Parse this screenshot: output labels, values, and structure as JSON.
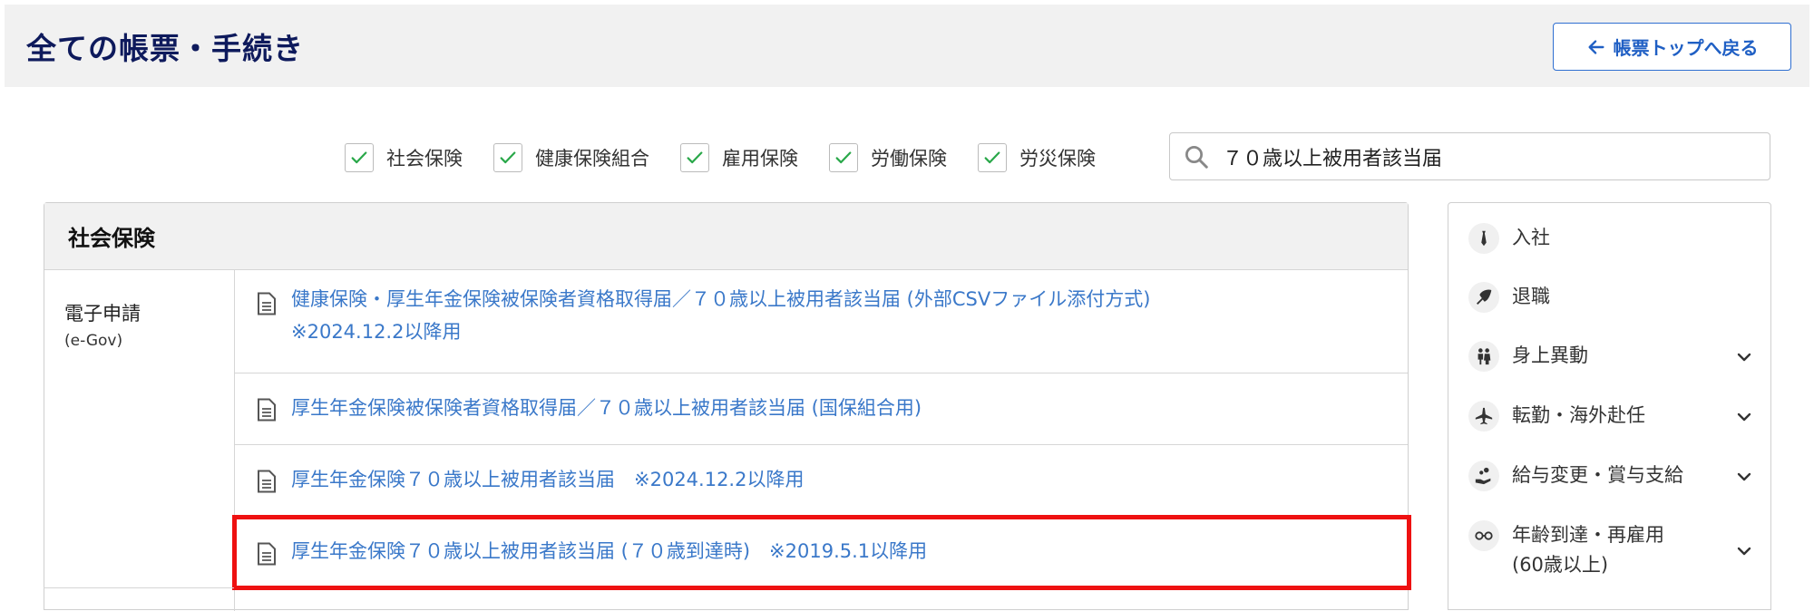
{
  "header": {
    "title": "全ての帳票・手続き",
    "back_label": "帳票トップへ戻る"
  },
  "filters": [
    {
      "label": "社会保険",
      "checked": true
    },
    {
      "label": "健康保険組合",
      "checked": true
    },
    {
      "label": "雇用保険",
      "checked": true
    },
    {
      "label": "労働保険",
      "checked": true
    },
    {
      "label": "労災保険",
      "checked": true
    }
  ],
  "search": {
    "value": "７０歳以上被用者該当届"
  },
  "panel": {
    "title": "社会保険",
    "category": {
      "title": "電子申請",
      "subtitle": "(e-Gov)"
    },
    "documents": [
      {
        "line1": "健康保険・厚生年金保険被保険者資格取得届／７０歳以上被用者該当届 (外部CSVファイル添付方式)",
        "line2": "※2024.12.2以降用"
      },
      {
        "line1": "厚生年金保険被保険者資格取得届／７０歳以上被用者該当届 (国保組合用)"
      },
      {
        "line1": "厚生年金保険７０歳以上被用者該当届　※2024.12.2以降用"
      },
      {
        "line1": "厚生年金保険７０歳以上被用者該当届 (７０歳到達時)　※2019.5.1以降用",
        "highlighted": true
      }
    ]
  },
  "sidebar": {
    "items": [
      {
        "label": "入社",
        "icon": "necktie-icon",
        "expandable": false
      },
      {
        "label": "退職",
        "icon": "bouquet-icon",
        "expandable": false
      },
      {
        "label": "身上異動",
        "icon": "couple-icon",
        "expandable": true
      },
      {
        "label": "転勤・海外赴任",
        "icon": "airplane-icon",
        "expandable": true
      },
      {
        "label": "給与変更・賞与支給",
        "icon": "coins-hand-icon",
        "expandable": true
      },
      {
        "label": "年齢到達・再雇用",
        "label2": "(60歳以上)",
        "icon": "glasses-icon",
        "expandable": true
      }
    ]
  },
  "colors": {
    "link": "#3a78c9",
    "title": "#0e1a5c",
    "highlight": "#ee1111",
    "check": "#2aa84a"
  }
}
